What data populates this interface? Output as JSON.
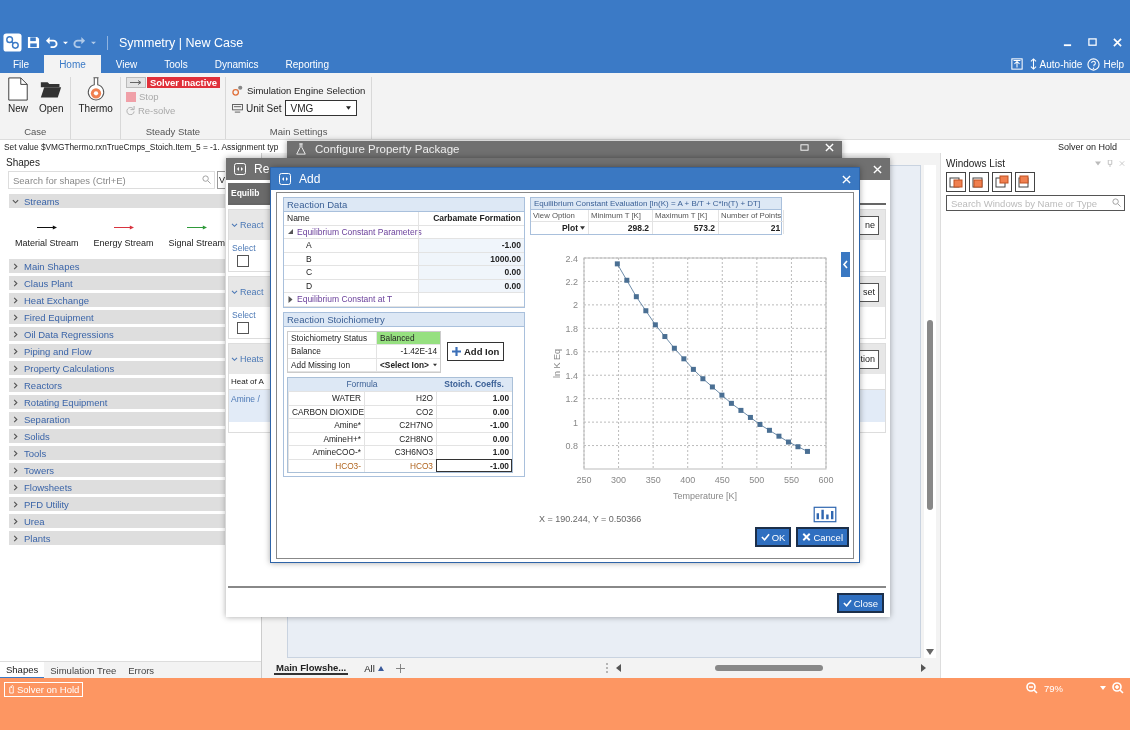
{
  "title_bar": {
    "title": "Symmetry | New Case",
    "auto_hide": "Auto-hide",
    "help": "Help"
  },
  "ribbon_tabs": [
    {
      "label": "File",
      "selected": false
    },
    {
      "label": "Home",
      "selected": true
    },
    {
      "label": "View",
      "selected": false
    },
    {
      "label": "Tools",
      "selected": false
    },
    {
      "label": "Dynamics",
      "selected": false
    },
    {
      "label": "Reporting",
      "selected": false
    }
  ],
  "ribbon": {
    "case": {
      "label": "Case",
      "new": "New",
      "open": "Open"
    },
    "thermo": "Thermo",
    "steady_state": {
      "label": "Steady State",
      "solver_status": "Solver Inactive",
      "stop": "Stop",
      "stop_disabled": true,
      "resolve": "Re-solve",
      "resolve_disabled": true
    },
    "main_settings": {
      "label": "Main Settings",
      "engine": "Simulation Engine Selection",
      "unit_set_label": "Unit Set",
      "unit_set": "VMG"
    }
  },
  "message_bar": {
    "message": "Set value $VMGThermo.rxnTrueCmps_Stoich.Item_5 = -1. Assignment typ",
    "solver_state": "Solver on Hold"
  },
  "shapes_panel": {
    "title": "Shapes",
    "search_placeholder": "Search for shapes (Ctrl+E)",
    "view_button": "V",
    "categories": [
      {
        "label": "Streams",
        "expanded": true,
        "items": [
          {
            "label": "Material Stream",
            "color": "#111111"
          },
          {
            "label": "Energy Stream",
            "color": "#d8343f"
          },
          {
            "label": "Signal Stream",
            "color": "#2f9a3a"
          }
        ]
      },
      {
        "label": "Main Shapes",
        "expanded": false
      },
      {
        "label": "Claus Plant",
        "expanded": false
      },
      {
        "label": "Heat Exchange",
        "expanded": false
      },
      {
        "label": "Fired Equipment",
        "expanded": false
      },
      {
        "label": "Oil Data Regressions",
        "expanded": false
      },
      {
        "label": "Piping and Flow",
        "expanded": false
      },
      {
        "label": "Property Calculations",
        "expanded": false
      },
      {
        "label": "Reactors",
        "expanded": false
      },
      {
        "label": "Rotating Equipment",
        "expanded": false
      },
      {
        "label": "Separation",
        "expanded": false
      },
      {
        "label": "Solids",
        "expanded": false
      },
      {
        "label": "Tools",
        "expanded": false
      },
      {
        "label": "Towers",
        "expanded": false
      },
      {
        "label": "Flowsheets",
        "expanded": false
      },
      {
        "label": "PFD Utility",
        "expanded": false
      },
      {
        "label": "Urea",
        "expanded": false
      },
      {
        "label": "Plants",
        "expanded": false
      }
    ],
    "tabs": [
      {
        "label": "Shapes",
        "selected": true
      },
      {
        "label": "Simulation Tree",
        "selected": false
      },
      {
        "label": "Errors",
        "selected": false
      }
    ]
  },
  "flowsheet_bar": {
    "tabs": [
      {
        "label": "Main Flowshe...",
        "selected": true
      }
    ],
    "filter": "All"
  },
  "windows_list": {
    "title": "Windows List",
    "search_placeholder": "Search Windows by Name or Type"
  },
  "configure_window": {
    "title": "Configure Property Package"
  },
  "reaction_window": {
    "title": "Re",
    "tab": "Equilib",
    "sections": [
      {
        "kind": "select",
        "title": "React",
        "select_label": "Select",
        "checked": false,
        "button": "ne"
      },
      {
        "kind": "select",
        "title": "React",
        "select_label": "Select",
        "checked": false,
        "button": "set"
      },
      {
        "kind": "table",
        "title": "Heats",
        "button": "tion",
        "column": "Heat of A",
        "row": "Amine /"
      }
    ],
    "close": "Close"
  },
  "add_dialog": {
    "title": "Add",
    "reaction_data": {
      "title": "Reaction Data",
      "name_label": "Name",
      "name": "Carbamate Formation",
      "groups": [
        {
          "label": "Equilibrium Constant Parameters",
          "expanded": true,
          "rows": [
            {
              "label": "A",
              "value": "-1.00"
            },
            {
              "label": "B",
              "value": "1000.00"
            },
            {
              "label": "C",
              "value": "0.00"
            },
            {
              "label": "D",
              "value": "0.00"
            }
          ]
        },
        {
          "label": "Equilibrium Constant at T",
          "expanded": false
        }
      ]
    },
    "stoichiometry": {
      "title": "Reaction Stoichiometry",
      "status_label": "Stoichiometry Status",
      "status": "Balanced",
      "balance_label": "Balance",
      "balance": "-1.42E-14",
      "missing_label": "Add Missing Ion",
      "missing": "<Select Ion>",
      "add_ion": "Add Ion",
      "formula_header": "Formula",
      "coeff_header": "Stoich. Coeffs.",
      "rows": [
        {
          "name": "WATER",
          "formula": "H2O",
          "coeff": "1.00",
          "selected": false
        },
        {
          "name": "CARBON DIOXIDE",
          "formula": "CO2",
          "coeff": "0.00",
          "selected": false
        },
        {
          "name": "Amine*",
          "formula": "C2H7NO",
          "coeff": "-1.00",
          "selected": false
        },
        {
          "name": "AmineH+*",
          "formula": "C2H8NO",
          "coeff": "0.00",
          "selected": false
        },
        {
          "name": "AmineCOO-*",
          "formula": "C3H6NO3",
          "coeff": "1.00",
          "selected": false
        },
        {
          "name": "HCO3-",
          "formula": "HCO3",
          "coeff": "-1.00",
          "selected": true
        }
      ]
    },
    "evaluation": {
      "title": "Equilibrium Constant Evaluation [ln(K) = A + B/T + C*ln(T) + DT]",
      "columns": [
        "View Option",
        "Minimum T [K]",
        "Maximum T [K]",
        "Number of Points"
      ],
      "values": [
        "Plot",
        "298.2",
        "573.2",
        "21"
      ]
    },
    "chart_data": {
      "type": "line",
      "xlabel": "Temperature [K]",
      "ylabel": "ln K Eq",
      "x": [
        298.2,
        311.95,
        325.7,
        339.45,
        353.2,
        366.95,
        380.7,
        394.45,
        408.2,
        421.95,
        435.7,
        449.45,
        463.2,
        476.95,
        490.7,
        504.45,
        518.2,
        531.95,
        545.7,
        559.45,
        573.2
      ],
      "series": [
        {
          "color": "#4a6f93",
          "marker": "square",
          "values": [
            2.35,
            2.21,
            2.07,
            1.95,
            1.83,
            1.73,
            1.63,
            1.54,
            1.45,
            1.37,
            1.3,
            1.23,
            1.16,
            1.1,
            1.04,
            0.98,
            0.93,
            0.88,
            0.83,
            0.79,
            0.75
          ]
        }
      ],
      "grid": true,
      "xlim": [
        250,
        600
      ],
      "ylim": [
        0.6,
        2.4
      ],
      "xticks": [
        250,
        300,
        350,
        400,
        450,
        500,
        550,
        600
      ],
      "yticks": [
        0.8,
        1,
        1.2,
        1.4,
        1.6,
        1.8,
        2,
        2.2,
        2.4
      ]
    },
    "cursor_readout": "X = 190.244, Y = 0.50366",
    "ok": "OK",
    "cancel": "Cancel"
  },
  "status_bar": {
    "solver_state": "Solver on Hold",
    "zoom": "79%"
  }
}
